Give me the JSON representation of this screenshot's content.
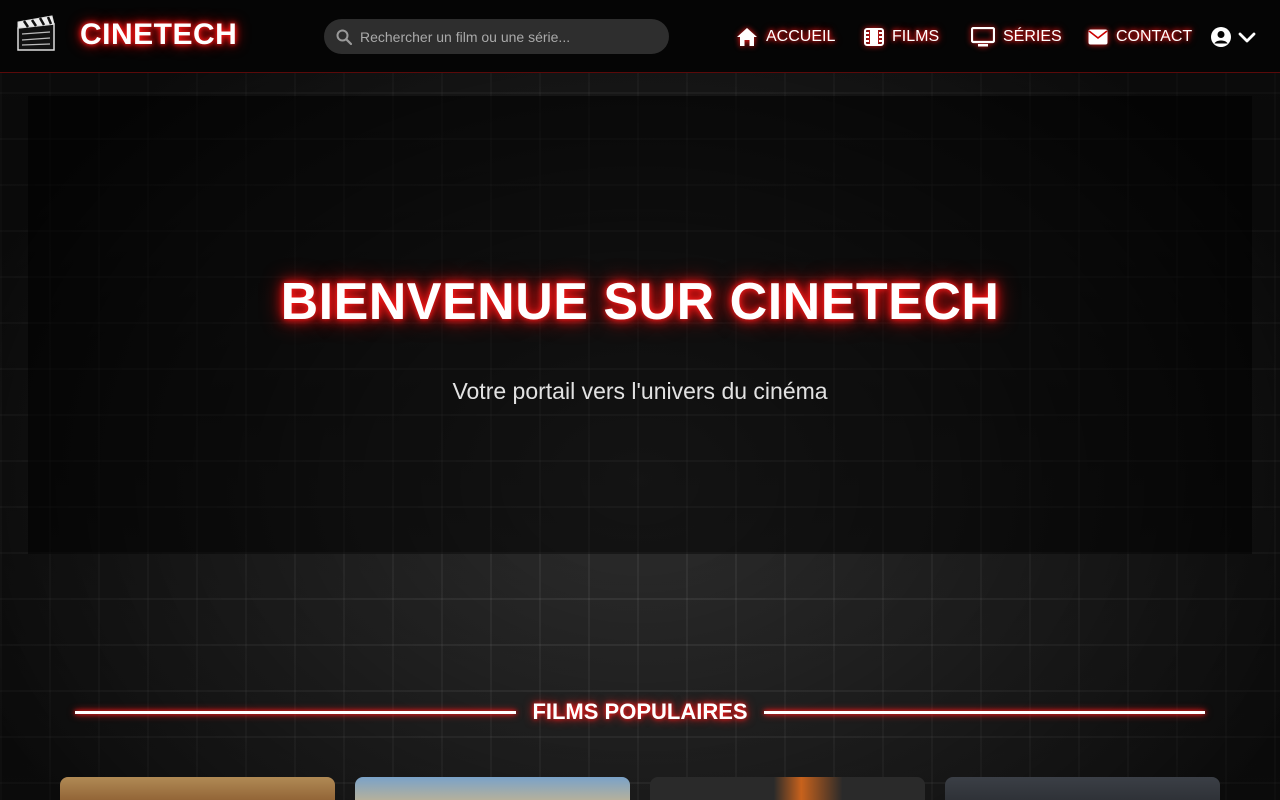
{
  "nav": {
    "brand": "CINETECH",
    "search_placeholder": "Rechercher un film ou une série...",
    "links": [
      {
        "label": "ACCUEIL",
        "icon": "home-icon"
      },
      {
        "label": "FILMS",
        "icon": "film-icon"
      },
      {
        "label": "SÉRIES",
        "icon": "tv-icon"
      },
      {
        "label": "CONTACT",
        "icon": "envelope-icon"
      }
    ],
    "user_icon": "user-circle-icon",
    "user_caret_icon": "chevron-down-icon"
  },
  "hero": {
    "title": "BIENVENUE SUR CINETECH",
    "subtitle": "Votre portail vers l'univers du cinéma"
  },
  "popular": {
    "title": "FILMS POPULAIRES"
  },
  "colors": {
    "accent_glow": "#ff1a1a",
    "navbar_bg": "#050505",
    "search_bg": "#2e2e2e"
  }
}
